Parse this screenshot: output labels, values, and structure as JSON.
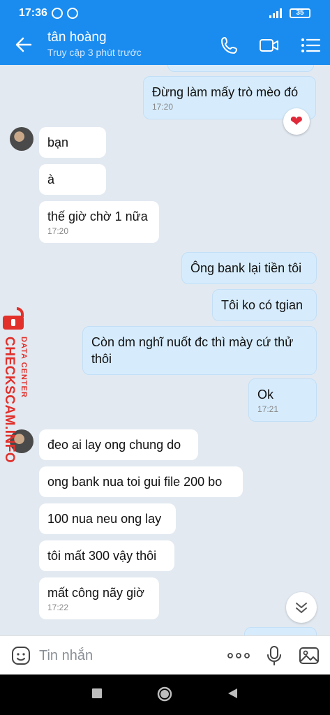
{
  "status_bar": {
    "time": "17:36",
    "battery": "35"
  },
  "header": {
    "contact_name": "tân hoàng",
    "status": "Truy cập 3 phút trước"
  },
  "messages": [
    {
      "dir": "out",
      "text": "Đừng làm mấy trò mèo đó",
      "time": "17:20",
      "reaction": "heart"
    },
    {
      "dir": "in",
      "text": "bạn"
    },
    {
      "dir": "in",
      "text": "à"
    },
    {
      "dir": "in",
      "text": "thế giờ chờ 1 nữa",
      "time": "17:20"
    },
    {
      "dir": "out",
      "text": "Ông bank lại tiền tôi"
    },
    {
      "dir": "out",
      "text": "Tôi ko có tgian"
    },
    {
      "dir": "out",
      "text": "Còn dm nghĩ nuốt đc thì mày cứ thử thôi"
    },
    {
      "dir": "out",
      "text": "Ok",
      "time": "17:21"
    },
    {
      "dir": "in",
      "text": "đeo ai lay ong chung do"
    },
    {
      "dir": "in",
      "text": "ong bank nua toi gui file 200 bo"
    },
    {
      "dir": "in",
      "text": "100 nua neu ong lay"
    },
    {
      "dir": "in",
      "text": "tôi mất 300 vậy thôi"
    },
    {
      "dir": "in",
      "text": "mất công nãy giờ",
      "time": "17:22"
    }
  ],
  "watermark": {
    "main": "CHECKSCAM.INFO",
    "sub": "DATA CENTER"
  },
  "input": {
    "placeholder": "Tin nhắn"
  },
  "icons": {
    "back": "arrow-left-icon",
    "call": "phone-icon",
    "video": "video-icon",
    "menu": "list-icon",
    "sticker": "sticker-icon",
    "more": "more-dots-icon",
    "mic": "microphone-icon",
    "image": "image-icon"
  },
  "colors": {
    "header": "#1a8cf0",
    "outgoing_bubble": "#d6ecfd",
    "incoming_bubble": "#ffffff",
    "background": "#e2e9f1",
    "watermark": "#e2302b"
  }
}
